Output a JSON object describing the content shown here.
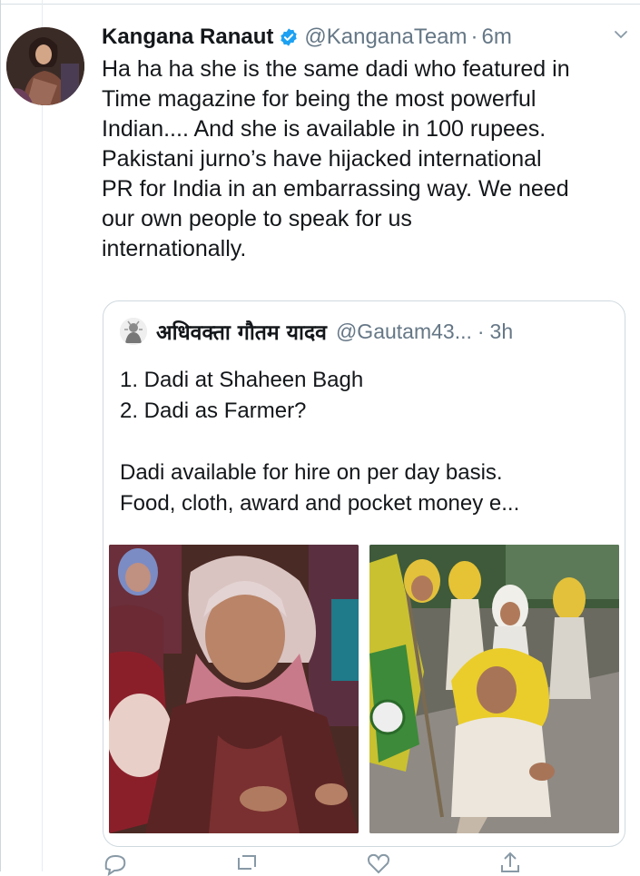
{
  "tweet": {
    "display_name": "Kangana Ranaut",
    "handle": "@KanganaTeam",
    "separator": "·",
    "time": "6m",
    "text": "Ha ha ha she is the same dadi who featured in\nTime magazine for being the most powerful\nIndian.... And she is available in 100 rupees.\nPakistani jurno’s have hijacked international\nPR for India in an embarrassing way. We need\nour own people to speak for us\ninternationally."
  },
  "quoted_tweet": {
    "display_name": "अधिवक्ता गौतम यादव",
    "handle": "@Gautam43...",
    "separator": "·",
    "time": "3h",
    "text": "1. Dadi at Shaheen Bagh\n2. Dadi as Farmer?\n\nDadi available for hire on per day basis.\nFood, cloth, award and pocket money e..."
  },
  "icons": {
    "verified": "verified-badge-icon",
    "more": "chevron-down-icon",
    "reply": "reply-icon",
    "retweet": "retweet-icon",
    "like": "like-icon",
    "share": "share-icon"
  },
  "colors": {
    "text": "#14171a",
    "secondary": "#657786",
    "verified": "#1da1f2",
    "border": "#cfd9de"
  }
}
